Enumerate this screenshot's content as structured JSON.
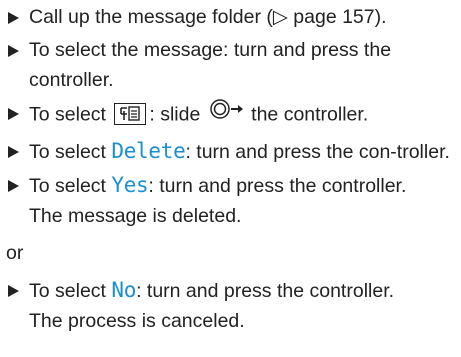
{
  "steps": [
    {
      "text": "Call up the message folder (▷ page 157)."
    },
    {
      "text": "To select the message: turn and press the controller."
    },
    {
      "pre": "To select",
      "icon": "message-options-icon",
      "mid": ": slide",
      "post": "the controller."
    },
    {
      "pre": "To select ",
      "soft": "Delete",
      "post": ": turn and press the con-troller."
    },
    {
      "pre": "To select ",
      "soft": "Yes",
      "post": ": turn and press the controller.",
      "result": "The message is deleted."
    }
  ],
  "or_label": "or",
  "steps_after": [
    {
      "pre": "To select ",
      "soft": "No",
      "post": ": turn and press the controller.",
      "result": "The process is canceled."
    }
  ],
  "colors": {
    "softkey": "#1a8fd6",
    "text": "#222222"
  }
}
